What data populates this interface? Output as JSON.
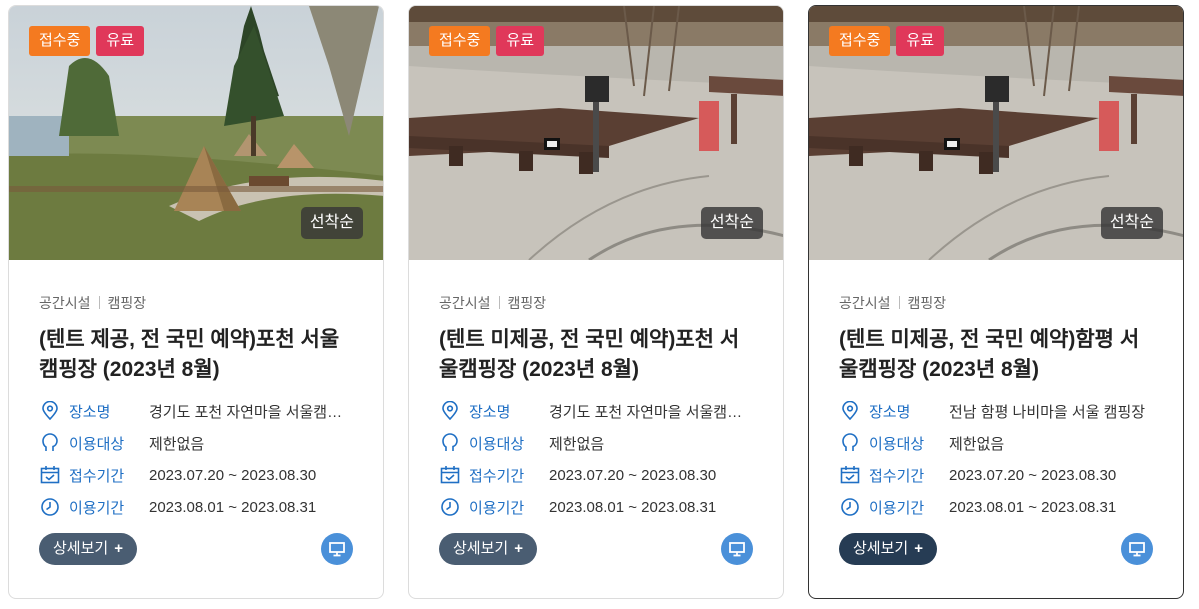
{
  "cards": [
    {
      "image_alt": "tent-campsite-photo",
      "badges": {
        "status": "접수중",
        "fee": "유료"
      },
      "first_come": "선착순",
      "category": "공간시설",
      "subcategory": "캠핑장",
      "title": "(텐트 제공, 전 국민 예약)포천 서울캠핑장 (2023년 8월)",
      "rows": [
        {
          "icon": "location-pin-icon",
          "label": "장소명",
          "value": "경기도 포천 자연마을 서울캠핑장"
        },
        {
          "icon": "user-icon",
          "label": "이용대상",
          "value": "제한없음"
        },
        {
          "icon": "calendar-icon",
          "label": "접수기간",
          "value": "2023.07.20 ~ 2023.08.30"
        },
        {
          "icon": "clock-icon",
          "label": "이용기간",
          "value": "2023.08.01 ~ 2023.08.31"
        }
      ],
      "detail_label": "상세보기",
      "detail_plus": "+"
    },
    {
      "image_alt": "deck-campsite-photo",
      "badges": {
        "status": "접수중",
        "fee": "유료"
      },
      "first_come": "선착순",
      "category": "공간시설",
      "subcategory": "캠핑장",
      "title": "(텐트 미제공, 전 국민 예약)포천 서울캠핑장 (2023년 8월)",
      "rows": [
        {
          "icon": "location-pin-icon",
          "label": "장소명",
          "value": "경기도 포천 자연마을 서울캠핑장"
        },
        {
          "icon": "user-icon",
          "label": "이용대상",
          "value": "제한없음"
        },
        {
          "icon": "calendar-icon",
          "label": "접수기간",
          "value": "2023.07.20 ~ 2023.08.30"
        },
        {
          "icon": "clock-icon",
          "label": "이용기간",
          "value": "2023.08.01 ~ 2023.08.31"
        }
      ],
      "detail_label": "상세보기",
      "detail_plus": "+"
    },
    {
      "image_alt": "deck-campsite-photo",
      "badges": {
        "status": "접수중",
        "fee": "유료"
      },
      "first_come": "선착순",
      "category": "공간시설",
      "subcategory": "캠핑장",
      "title": "(텐트 미제공, 전 국민 예약)함평 서울캠핑장 (2023년 8월)",
      "rows": [
        {
          "icon": "location-pin-icon",
          "label": "장소명",
          "value": "전남 함평 나비마을 서울 캠핑장"
        },
        {
          "icon": "user-icon",
          "label": "이용대상",
          "value": "제한없음"
        },
        {
          "icon": "calendar-icon",
          "label": "접수기간",
          "value": "2023.07.20 ~ 2023.08.30"
        },
        {
          "icon": "clock-icon",
          "label": "이용기간",
          "value": "2023.08.01 ~ 2023.08.31"
        }
      ],
      "detail_label": "상세보기",
      "detail_plus": "+"
    }
  ],
  "colors": {
    "status_badge": "#f47a20",
    "fee_badge": "#e0385a",
    "label_blue": "#1f6fc4",
    "detail_button": "#4a5d72",
    "pc_button": "#4a90d9"
  }
}
